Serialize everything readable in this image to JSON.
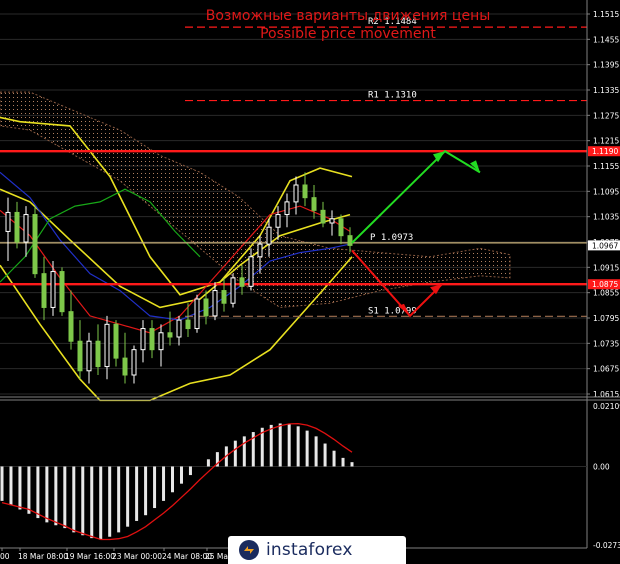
{
  "chart_data": [
    {
      "type": "candlestick",
      "title": "Возможные варианты движения цены",
      "subtitle": "Possible price movement",
      "y_ticks": [
        "1.1515",
        "1.1455",
        "1.1395",
        "1.1335",
        "1.1275",
        "1.1215",
        "1.1155",
        "1.1095",
        "1.1035",
        "1.0975",
        "1.0915",
        "1.0855",
        "1.0795",
        "1.0735",
        "1.0675",
        "1.0615"
      ],
      "ylim": [
        1.0615,
        1.1515
      ],
      "x_ticks": [
        "00",
        "18 Mar 08:00",
        "19 Mar 16:00",
        "23 Mar 00:00",
        "24 Mar 08:00",
        "25 Ma"
      ],
      "current_price": "1.0967",
      "highlighted_prices": [
        {
          "label": "1.1190",
          "value": 1.119,
          "color": "#ff1a1a"
        },
        {
          "label": "1.0875",
          "value": 1.0875,
          "color": "#ff1a1a"
        }
      ],
      "levels": [
        {
          "name": "R2",
          "label": "R2 1.1484",
          "value": 1.1484,
          "style": "dashed",
          "color": "#ff1a1a"
        },
        {
          "name": "R1",
          "label": "R1 1.1310",
          "value": 1.131,
          "style": "dashed",
          "color": "#ff1a1a"
        },
        {
          "name": "",
          "label": "",
          "value": 1.119,
          "style": "solid",
          "color": "#ff1a1a"
        },
        {
          "name": "P",
          "label": "P 1.0973",
          "value": 1.0973,
          "style": "solid",
          "color": "#c8b078"
        },
        {
          "name": "",
          "label": "",
          "value": 1.0875,
          "style": "solid",
          "color": "#ff1a1a"
        },
        {
          "name": "S1",
          "label": "S1 1.0799",
          "value": 1.0799,
          "style": "dashed",
          "color": "#a07050"
        }
      ],
      "candles": [
        [
          1.1,
          1.108,
          1.093,
          1.1045
        ],
        [
          1.1045,
          1.107,
          1.096,
          1.0975
        ],
        [
          1.0975,
          1.106,
          1.094,
          1.104
        ],
        [
          1.104,
          1.106,
          1.089,
          1.09
        ],
        [
          1.09,
          1.094,
          1.079,
          1.082
        ],
        [
          1.082,
          1.093,
          1.08,
          1.0905
        ],
        [
          1.0905,
          1.0915,
          1.08,
          1.081
        ],
        [
          1.081,
          1.086,
          1.072,
          1.074
        ],
        [
          1.074,
          1.079,
          1.065,
          1.067
        ],
        [
          1.067,
          1.076,
          1.064,
          1.074
        ],
        [
          1.074,
          1.078,
          1.066,
          1.068
        ],
        [
          1.068,
          1.08,
          1.065,
          1.078
        ],
        [
          1.078,
          1.079,
          1.068,
          1.07
        ],
        [
          1.07,
          1.076,
          1.064,
          1.066
        ],
        [
          1.066,
          1.073,
          1.064,
          1.072
        ],
        [
          1.072,
          1.079,
          1.069,
          1.077
        ],
        [
          1.077,
          1.079,
          1.07,
          1.072
        ],
        [
          1.072,
          1.078,
          1.068,
          1.076
        ],
        [
          1.076,
          1.081,
          1.073,
          1.075
        ],
        [
          1.075,
          1.08,
          1.073,
          1.079
        ],
        [
          1.079,
          1.083,
          1.075,
          1.077
        ],
        [
          1.077,
          1.085,
          1.076,
          1.084
        ],
        [
          1.084,
          1.086,
          1.078,
          1.08
        ],
        [
          1.08,
          1.088,
          1.079,
          1.086
        ],
        [
          1.086,
          1.089,
          1.081,
          1.083
        ],
        [
          1.083,
          1.09,
          1.082,
          1.089
        ],
        [
          1.089,
          1.092,
          1.085,
          1.087
        ],
        [
          1.087,
          1.096,
          1.086,
          1.094
        ],
        [
          1.094,
          1.099,
          1.09,
          1.097
        ],
        [
          1.097,
          1.103,
          1.094,
          1.101
        ],
        [
          1.101,
          1.106,
          1.098,
          1.104
        ],
        [
          1.104,
          1.109,
          1.101,
          1.107
        ],
        [
          1.107,
          1.113,
          1.104,
          1.111
        ],
        [
          1.111,
          1.114,
          1.106,
          1.108
        ],
        [
          1.108,
          1.111,
          1.103,
          1.105
        ],
        [
          1.105,
          1.107,
          1.101,
          1.102
        ],
        [
          1.102,
          1.105,
          1.099,
          1.103
        ],
        [
          1.103,
          1.104,
          1.097,
          1.099
        ],
        [
          1.099,
          1.101,
          1.095,
          1.0967
        ]
      ],
      "forecast_up": [
        [
          1.0973,
          1.119
        ],
        [
          1.119,
          1.114
        ]
      ],
      "forecast_down": [
        [
          1.0955,
          1.08
        ],
        [
          1.08,
          1.0875
        ]
      ],
      "ichimoku_cloud": "brown dotted area",
      "oscillator": {
        "type": "histogram",
        "y_ticks": [
          "0.02109",
          "0.00",
          "-0.02739"
        ],
        "ylim": [
          -0.02739,
          0.02109
        ],
        "values": [
          -0.012,
          -0.0135,
          -0.015,
          -0.0165,
          -0.018,
          -0.0195,
          -0.0205,
          -0.0215,
          -0.023,
          -0.024,
          -0.025,
          -0.0255,
          -0.0245,
          -0.023,
          -0.021,
          -0.019,
          -0.017,
          -0.0145,
          -0.012,
          -0.009,
          -0.006,
          -0.003,
          0.0,
          0.0025,
          0.005,
          0.007,
          0.009,
          0.0105,
          0.012,
          0.0135,
          0.0145,
          0.015,
          0.0148,
          0.014,
          0.0125,
          0.0105,
          0.008,
          0.0055,
          0.003,
          0.0015
        ],
        "signal_color": "#e01010"
      }
    }
  ],
  "watermark": {
    "text": "instaforex"
  }
}
